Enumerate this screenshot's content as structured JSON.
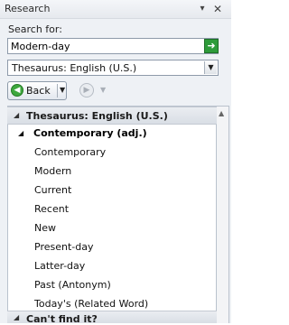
{
  "pane": {
    "title": "Research",
    "menu_glyph": "▾",
    "close_glyph": "✕"
  },
  "search": {
    "label": "Search for:",
    "value": "Modern-day",
    "go_glyph": "➜"
  },
  "source": {
    "selected": "Thesaurus: English (U.S.)"
  },
  "nav": {
    "back_label": "Back"
  },
  "results": {
    "section_title": "Thesaurus: English (U.S.)",
    "group_title": "Contemporary (adj.)",
    "words": [
      "Contemporary",
      "Modern",
      "Current",
      "Recent",
      "New",
      "Present-day",
      "Latter-day",
      "Past (Antonym)",
      "Today's (Related Word)"
    ],
    "cant_find_title": "Can't find it?"
  }
}
